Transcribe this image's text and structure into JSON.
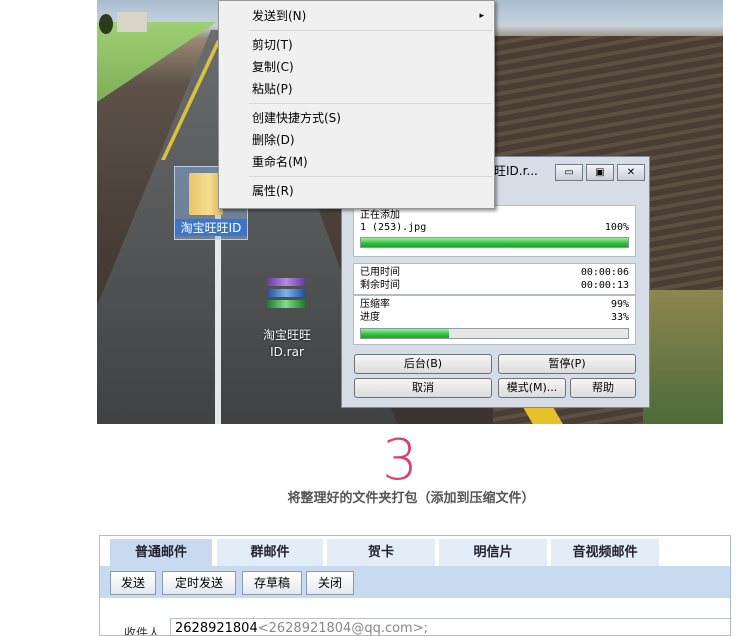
{
  "context_menu": {
    "items": [
      {
        "label": "发送到(N)",
        "submenu": true
      },
      {
        "label": "剪切(T)"
      },
      {
        "label": "复制(C)"
      },
      {
        "label": "粘贴(P)"
      },
      {
        "label": "创建快捷方式(S)"
      },
      {
        "label": "删除(D)"
      },
      {
        "label": "重命名(M)"
      },
      {
        "label": "属性(R)"
      }
    ],
    "submenu_arrow": "▸"
  },
  "desktop": {
    "folder_label": "淘宝旺旺ID",
    "rar_label_line1": "淘宝旺旺",
    "rar_label_line2": "ID.rar"
  },
  "dialog": {
    "title": "旺旺ID.r...",
    "window_buttons": [
      "▭",
      "▣",
      "✕"
    ],
    "status_label": "正在添加",
    "file_name": "1 (253).jpg",
    "file_percent": "100%",
    "file_progress": 1.0,
    "elapsed_label": "已用时间",
    "elapsed_value": "00:00:06",
    "remaining_label": "剩余时间",
    "remaining_value": "00:00:13",
    "ratio_label": "压缩率",
    "ratio_value": "99%",
    "progress_label": "进度",
    "progress_value": "33%",
    "overall_progress": 0.33,
    "buttons": {
      "background": "后台(B)",
      "pause": "暂停(P)",
      "cancel": "取消",
      "mode": "模式(M)...",
      "help": "帮助"
    }
  },
  "step": {
    "number": "3",
    "caption": "将整理好的文件夹打包（添加到压缩文件）"
  },
  "mail": {
    "tabs": [
      "普通邮件",
      "群邮件",
      "贺卡",
      "明信片",
      "音视频邮件"
    ],
    "active_tab": 0,
    "toolbar": [
      "发送",
      "定时发送",
      "存草稿",
      "关闭"
    ],
    "recipient_label": "收件人",
    "recipient_name": "2628921804",
    "recipient_address": "<2628921804@qq.com>;"
  }
}
